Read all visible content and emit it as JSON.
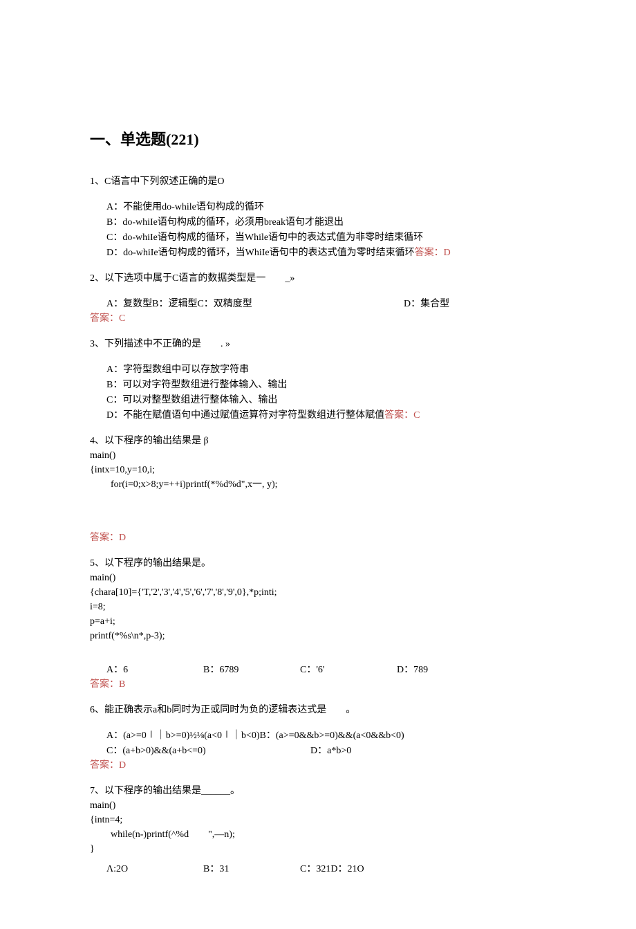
{
  "heading": "一、单选题(221)",
  "q1": {
    "stem": "1、C语言中下列叙述正确的是O",
    "optA": "A：不能使用do-while语句构成的循环",
    "optB": "B：do-whiIe语句构成的循环，必须用break语句才能退出",
    "optC": "C：do-whiIe语句构成的循环，当While语句中的表达式值为非零时结束循环",
    "optD_prefix": "D：do-whiIe语句构成的循环，当WhiIe语句中的表达式值为零时结束循环",
    "answer": "答案：D"
  },
  "q2": {
    "stem": "2、以下选项中属于C语言的数据类型是一  _»",
    "optA": "A：复数型B：逻辑型C：双精度型",
    "optD": "D：集合型",
    "answer": "答案：C"
  },
  "q3": {
    "stem": "3、下列描述中不正确的是  . »",
    "optA": "A：字符型数组中可以存放字符串",
    "optB": "B：可以对字符型数组进行整体输入、输出",
    "optC": "C：可以对整型数组进行整体输入、输出",
    "optD_prefix": "D：不能在赋值语句中通过赋值运算符对字符型数组进行整体赋值",
    "answer": "答案：C"
  },
  "q4": {
    "stem": "4、以下程序的输出结果是 β",
    "line1": "main()",
    "line2": "{intx=10,y=10,i;",
    "line3": " for(i=0;x>8;y=++i)printf(*%d%d\",x一, y);",
    "answer": "答案：D"
  },
  "q5": {
    "stem": "5、以下程序的输出结果是。",
    "line1": "main()",
    "line2": "{chara[10]={'T,'2','3','4','5','6','7','8','9',0},*p;inti;",
    "line3": "i=8;",
    "line4": "p=a+i;",
    "line5": "printf(*%s\\n*,p-3);",
    "optA": "A：6",
    "optB": "B：6789",
    "optC": "C：'6'",
    "optD": "D：789",
    "answer": "答案：B"
  },
  "q6": {
    "stem": "6、能正确表示a和b同时为正或同时为负的逻辑表达式是  。",
    "optA": "A：(a>=0∣｜b>=0)½⅛(a<0∣｜b<0)B：(a>=0&&b>=0)&&(a<0&&b<0)",
    "optC": "C：(a+b>0)&&(a+b<=0)",
    "optD": "D：a*b>0",
    "answer": "答案：D"
  },
  "q7": {
    "stem": "7、以下程序的输出结果是______。",
    "line1": "main()",
    "line2": "{intn=4;",
    "line3": " while(n-)printf(^%d  \",—n);",
    "line4": "}",
    "optA": "Λ:2O",
    "optB": "B：31",
    "optC": "C：321D：21O"
  }
}
